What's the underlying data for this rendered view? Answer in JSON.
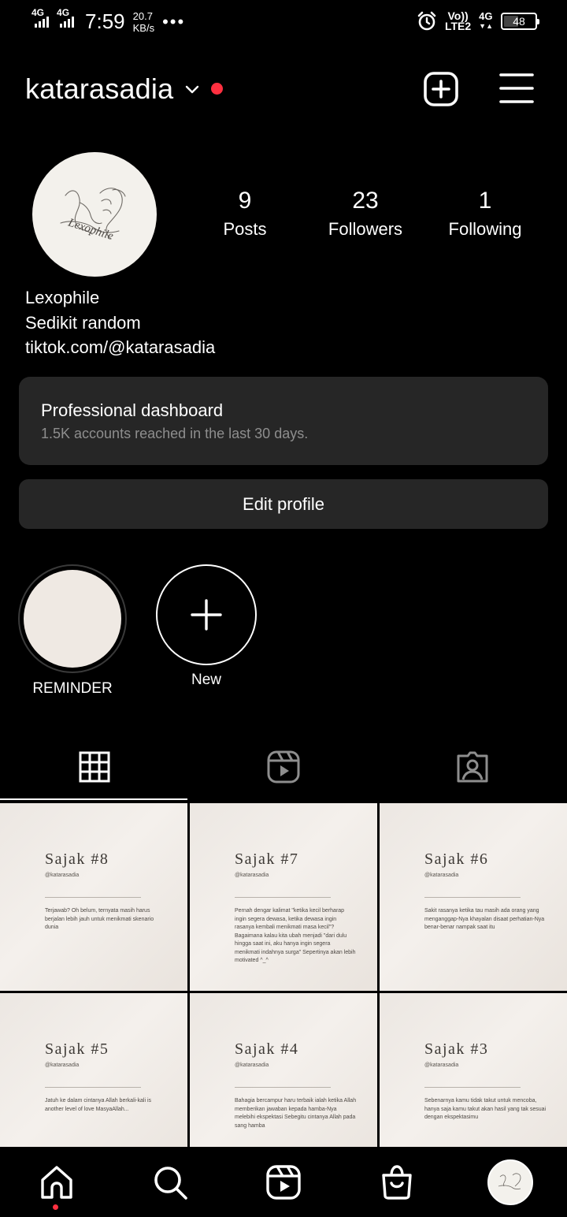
{
  "status_bar": {
    "net1": "4G",
    "net2": "4G",
    "time": "7:59",
    "speed_value": "20.7",
    "speed_unit": "KB/s",
    "more": "•••",
    "volte_top": "Vo))",
    "volte_bottom": "LTE2",
    "net3": "4G",
    "battery": "48"
  },
  "header": {
    "username": "katarasadia"
  },
  "profile": {
    "stats": [
      {
        "value": "9",
        "label": "Posts"
      },
      {
        "value": "23",
        "label": "Followers"
      },
      {
        "value": "1",
        "label": "Following"
      }
    ],
    "bio": [
      "Lexophile",
      "Sedikit random",
      "tiktok.com/@katarasadia"
    ],
    "avatar_signature": "Lexophile"
  },
  "dashboard": {
    "title": "Professional dashboard",
    "subtitle": "1.5K accounts reached in the last 30 days."
  },
  "edit_profile_label": "Edit profile",
  "highlights": [
    {
      "label": "REMINDER"
    },
    {
      "label": "New"
    }
  ],
  "posts": [
    {
      "title": "Sajak #8",
      "handle": "@katarasadia",
      "text": "Terjawab? Oh belum, ternyata masih harus berjalan lebih jauh untuk menikmati skenario dunia"
    },
    {
      "title": "Sajak #7",
      "handle": "@katarasadia",
      "text": "Pernah dengar kalimat \"ketika kecil berharap ingin segera dewasa, ketika dewasa ingin rasanya kembali menikmati masa kecil\"? Bagaimana kalau kita ubah menjadi \"dari dulu hingga saat ini, aku hanya ingin segera menikmati indahnya surga\" Sepertinya akan lebih motivated ^_^"
    },
    {
      "title": "Sajak #6",
      "handle": "@katarasadia",
      "text": "Sakit rasanya ketika tau masih ada orang yang menganggap-Nya khayalan disaat perhatian-Nya benar-benar nampak saat itu"
    },
    {
      "title": "Sajak #5",
      "handle": "@katarasadia",
      "text": "Jatuh ke dalam cintanya Allah berkali-kali is another level of love MasyaAllah..."
    },
    {
      "title": "Sajak #4",
      "handle": "@katarasadia",
      "text": "Bahagia bercampur haru terbaik ialah ketika Allah memberikan jawaban kepada hamba-Nya melebihi ekspektasi Sebegitu cintanya Allah pada sang hamba"
    },
    {
      "title": "Sajak #3",
      "handle": "@katarasadia",
      "text": "Sebenarnya kamu tidak takut untuk mencoba, hanya saja kamu takut akan hasil yang tak sesuai dengan ekspektasimu"
    }
  ],
  "icons": {
    "create": "plus-square-icon",
    "menu": "hamburger-menu-icon",
    "grid_tab": "grid-icon",
    "reels_tab": "reels-icon",
    "tagged_tab": "tagged-person-icon",
    "nav": [
      "home-icon",
      "search-icon",
      "reels-icon",
      "shop-icon",
      "profile-avatar"
    ]
  },
  "colors": {
    "background": "#000000",
    "card": "#262626",
    "muted_text": "#8e8e8e",
    "notification": "#ff3040"
  }
}
